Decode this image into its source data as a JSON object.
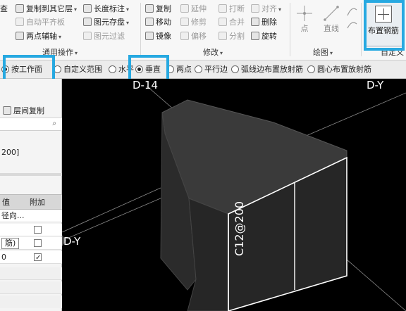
{
  "ribbon": {
    "general_ops": {
      "label": "通用操作",
      "items": [
        {
          "label": "查",
          "disabled": false
        },
        {
          "label": "复制到其它层",
          "disabled": false
        },
        {
          "label": "自动平齐板",
          "disabled": true
        },
        {
          "label": "两点辅轴",
          "disabled": false
        },
        {
          "label": "长度标注",
          "disabled": false
        },
        {
          "label": "图元存盘",
          "disabled": false
        },
        {
          "label": "图元过滤",
          "disabled": true
        }
      ]
    },
    "modify": {
      "label": "修改",
      "items": [
        {
          "label": "复制",
          "disabled": false
        },
        {
          "label": "移动",
          "disabled": false
        },
        {
          "label": "镜像",
          "disabled": false
        },
        {
          "label": "延伸",
          "disabled": true
        },
        {
          "label": "修剪",
          "disabled": true
        },
        {
          "label": "偏移",
          "disabled": true
        },
        {
          "label": "打断",
          "disabled": true
        },
        {
          "label": "合并",
          "disabled": true
        },
        {
          "label": "分割",
          "disabled": true
        },
        {
          "label": "对齐",
          "disabled": true
        },
        {
          "label": "删除",
          "disabled": false
        },
        {
          "label": "旋转",
          "disabled": false
        }
      ]
    },
    "draw": {
      "label": "绘图",
      "items": [
        {
          "label": "点"
        },
        {
          "label": "直线"
        },
        {
          "label": ""
        }
      ]
    },
    "custom": {
      "label": "自定义",
      "button_label": "布置钢筋"
    }
  },
  "optbar": {
    "items": [
      {
        "label": "按工作面",
        "selected": true
      },
      {
        "label": "自定义范围",
        "selected": false
      },
      {
        "label": "水平",
        "selected": false
      },
      {
        "label": "垂直",
        "selected": true
      },
      {
        "label": "两点",
        "selected": false
      },
      {
        "label": "平行边",
        "selected": false
      },
      {
        "label": "弧线边布置放射筋",
        "selected": false
      },
      {
        "label": "圆心布置放射筋",
        "selected": false
      }
    ]
  },
  "leftpanel": {
    "layer_copy": "层间复制",
    "field_value": "200]",
    "col_value": "值",
    "col_extra": "附加",
    "rows": [
      {
        "value": "径向...",
        "checked": null
      },
      {
        "value": "",
        "checked": false
      },
      {
        "value": "筋)",
        "checked": false
      },
      {
        "value": "0",
        "checked": true
      }
    ]
  },
  "canvas": {
    "labels": {
      "top_left": "D-14",
      "top_right": "D-Y",
      "left": "D-Y",
      "rebar": "C12@200"
    }
  }
}
